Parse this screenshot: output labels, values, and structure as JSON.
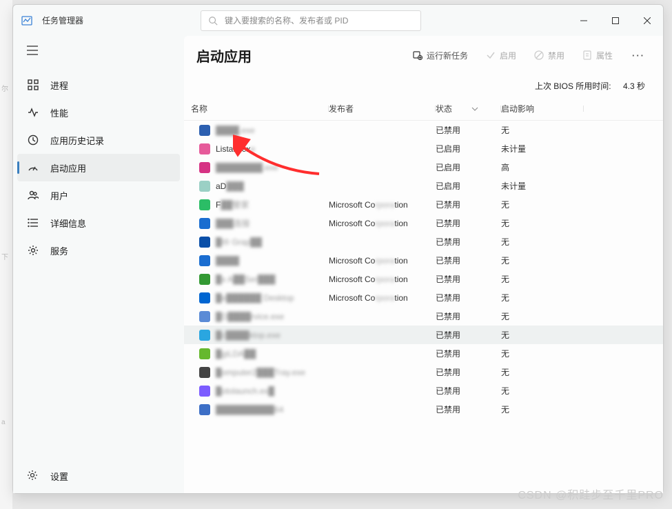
{
  "window": {
    "title": "任务管理器"
  },
  "search": {
    "placeholder": "键入要搜索的名称、发布者或 PID"
  },
  "sidebar": {
    "items": [
      {
        "label": "进程"
      },
      {
        "label": "性能"
      },
      {
        "label": "应用历史记录"
      },
      {
        "label": "启动应用"
      },
      {
        "label": "用户"
      },
      {
        "label": "详细信息"
      },
      {
        "label": "服务"
      }
    ],
    "settings_label": "设置"
  },
  "header": {
    "title": "启动应用",
    "run_task": "运行新任务",
    "enable": "启用",
    "disable": "禁用",
    "properties": "属性"
  },
  "bios": {
    "label": "上次 BIOS 所用时间:",
    "value": "4.3 秒"
  },
  "columns": {
    "name": "名称",
    "publisher": "发布者",
    "status": "状态",
    "impact": "启动影响"
  },
  "rows": [
    {
      "name_pre": "",
      "name_clear": "",
      "name_blur": "████.exe",
      "pub": "",
      "status": "已禁用",
      "impact": "无",
      "ic": "#2c5fb0"
    },
    {
      "name_pre": "",
      "name_clear": "Listary.ex",
      "name_blur": "e",
      "pub": "",
      "status": "已启用",
      "impact": "未计量",
      "ic": "#e65a9a"
    },
    {
      "name_pre": "",
      "name_clear": "",
      "name_blur": "████████.exe",
      "pub": "",
      "status": "已启用",
      "impact": "高",
      "ic": "#d63384"
    },
    {
      "name_pre": "",
      "name_clear": "aD",
      "name_blur": "███",
      "pub": "",
      "status": "已启用",
      "impact": "未计量",
      "ic": "#9bd0c5"
    },
    {
      "name_pre": "",
      "name_clear": "F",
      "name_blur": "██管家",
      "pub": "Microsoft Corporation",
      "status": "已禁用",
      "impact": "无",
      "ic": "#2bbd66"
    },
    {
      "name_pre": "",
      "name_clear": "",
      "name_blur": "███连接",
      "pub": "Microsoft Corporation",
      "status": "已禁用",
      "impact": "无",
      "ic": "#1a6dd0"
    },
    {
      "name_pre": "",
      "name_clear": "",
      "name_blur": "█l® Grap██",
      "pub": "",
      "status": "已禁用",
      "impact": "无",
      "ic": "#0a4fa8"
    },
    {
      "name_pre": "",
      "name_clear": "",
      "name_blur": "████",
      "pub": "Microsoft Corporation",
      "status": "已禁用",
      "impact": "无",
      "ic": "#1a6dd0"
    },
    {
      "name_pre": "",
      "name_clear": "",
      "name_blur": "█x A██Ser███",
      "pub": "Microsoft Corporation",
      "status": "已禁用",
      "impact": "无",
      "ic": "#339933"
    },
    {
      "name_pre": "",
      "name_clear": "",
      "name_blur": "█e██████ Desktop",
      "pub": "Microsoft Corporation",
      "status": "已禁用",
      "impact": "无",
      "ic": "#0065d1"
    },
    {
      "name_pre": "",
      "name_clear": "",
      "name_blur": "█D████rvice.exe",
      "pub": "",
      "status": "已禁用",
      "impact": "无",
      "ic": "#5b8bd6"
    },
    {
      "name_pre": "",
      "name_clear": "",
      "name_blur": "█c████ktop.exe",
      "pub": "",
      "status": "已禁用",
      "impact": "无",
      "ic": "#2aa6e0",
      "sel": true
    },
    {
      "name_pre": "",
      "name_clear": "",
      "name_blur": "█giLDA██",
      "pub": "",
      "status": "已禁用",
      "impact": "无",
      "ic": "#66b82e"
    },
    {
      "name_pre": "",
      "name_clear": "",
      "name_blur": "█omputer2███Tray.exe",
      "pub": "",
      "status": "已禁用",
      "impact": "无",
      "ic": "#444"
    },
    {
      "name_pre": "",
      "name_clear": "",
      "name_blur": "█otolaunch.ex█",
      "pub": "",
      "status": "已禁用",
      "impact": "无",
      "ic": "#7c5cff"
    },
    {
      "name_pre": "",
      "name_clear": "",
      "name_blur": "██████████64",
      "pub": "",
      "status": "已禁用",
      "impact": "无",
      "ic": "#3d6fc6"
    }
  ],
  "watermark": "CSDN @积跬步至千里PRO"
}
